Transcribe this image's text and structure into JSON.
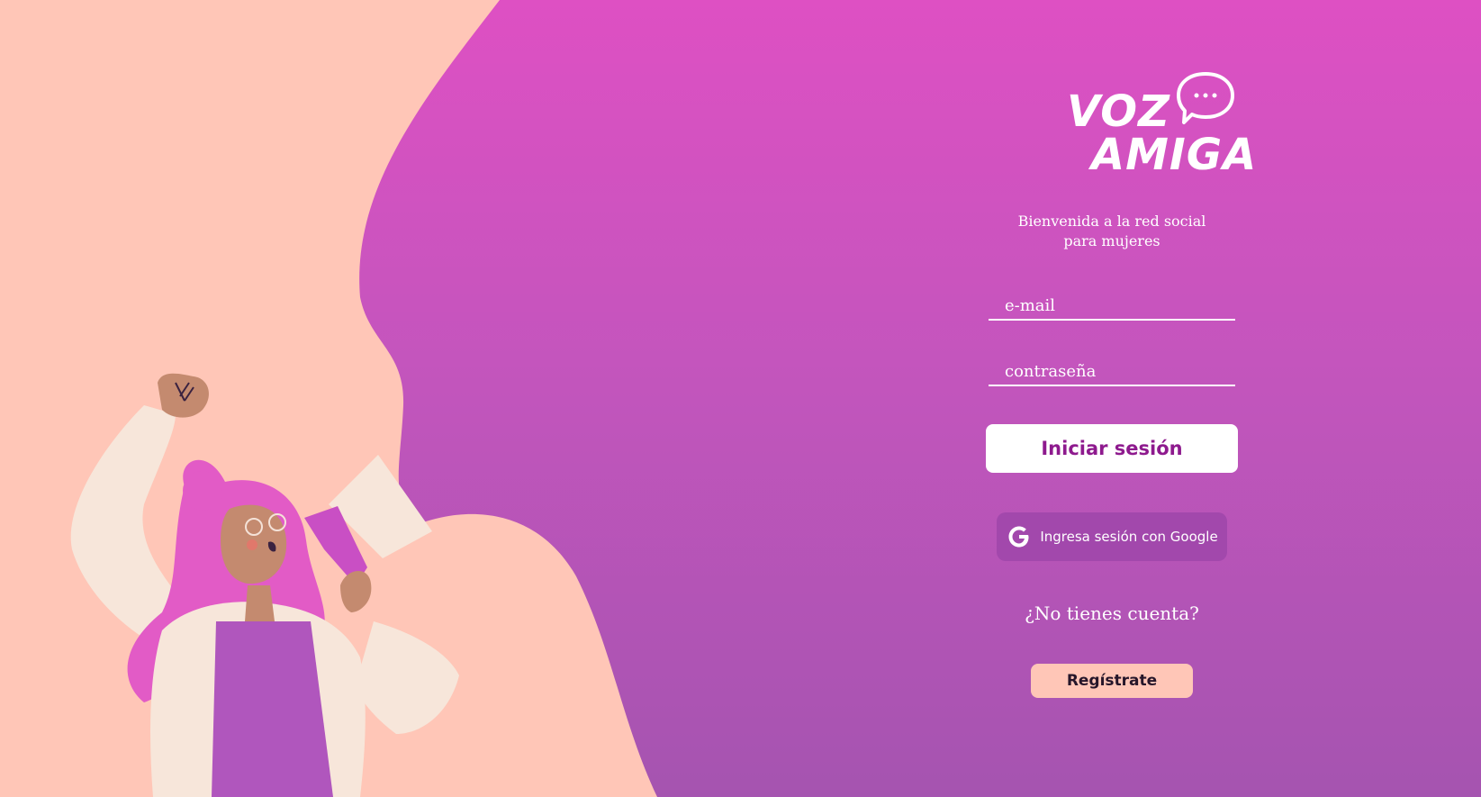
{
  "logo": {
    "line1": "VOZ",
    "line2": "AMIGA",
    "icon": "speech-bubble-icon"
  },
  "tagline": {
    "line1": "Bienvenida a la red social",
    "line2": "para mujeres"
  },
  "form": {
    "email_placeholder": "e-mail",
    "password_placeholder": "contraseña",
    "login_label": "Iniciar sesión",
    "google_label": "Ingresa sesión con Google",
    "google_icon": "google-icon",
    "no_account_text": "¿No tienes cuenta?",
    "register_label": "Regístrate"
  },
  "colors": {
    "gradient_top": "#de50c3",
    "gradient_bottom": "#a554b0",
    "peach": "#ffc6b7",
    "login_text": "#8e1a8e",
    "google_button": "#a248ac"
  },
  "illustration": {
    "subject": "woman-with-megaphone-illustration"
  }
}
